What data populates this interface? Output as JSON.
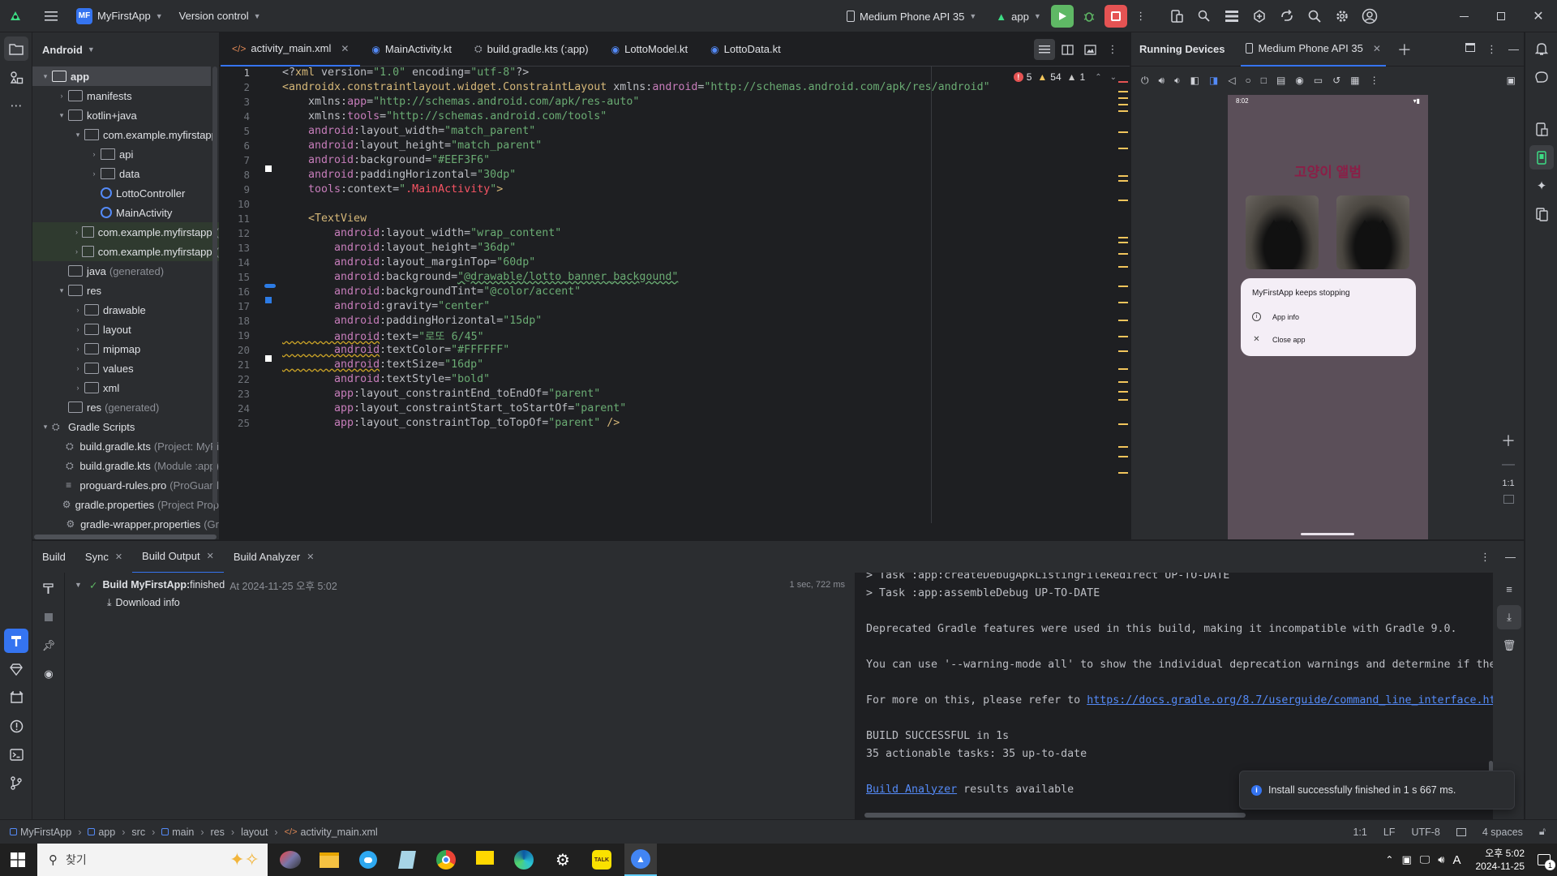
{
  "titlebar": {
    "project_badge": "MF",
    "project_name": "MyFirstApp",
    "vcs": "Version control",
    "device": "Medium Phone API 35",
    "run_config": "app"
  },
  "project_panel": {
    "title": "Android",
    "rows": [
      {
        "label": "app",
        "muted": "",
        "depth": 0,
        "arrow": "▾",
        "icon": "folder"
      },
      {
        "label": "manifests",
        "muted": "",
        "depth": 1,
        "arrow": "›",
        "icon": "folder"
      },
      {
        "label": "kotlin+java",
        "muted": "",
        "depth": 1,
        "arrow": "▾",
        "icon": "folder"
      },
      {
        "label": "com.example.myfirstapp",
        "muted": "",
        "depth": 2,
        "arrow": "▾",
        "icon": "package"
      },
      {
        "label": "api",
        "muted": "",
        "depth": 3,
        "arrow": "›",
        "icon": "package"
      },
      {
        "label": "data",
        "muted": "",
        "depth": 3,
        "arrow": "›",
        "icon": "package"
      },
      {
        "label": "LottoController",
        "muted": "",
        "depth": 3,
        "arrow": "",
        "icon": "kotlin"
      },
      {
        "label": "MainActivity",
        "muted": "",
        "depth": 3,
        "arrow": "",
        "icon": "kotlin"
      },
      {
        "label": "com.example.myfirstapp",
        "muted": "(",
        "depth": 2,
        "arrow": "›",
        "icon": "package"
      },
      {
        "label": "com.example.myfirstapp",
        "muted": "(",
        "depth": 2,
        "arrow": "›",
        "icon": "package"
      },
      {
        "label": "java",
        "muted": "(generated)",
        "depth": 1,
        "arrow": "",
        "icon": "folder"
      },
      {
        "label": "res",
        "muted": "",
        "depth": 1,
        "arrow": "▾",
        "icon": "folder"
      },
      {
        "label": "drawable",
        "muted": "",
        "depth": 2,
        "arrow": "›",
        "icon": "folder"
      },
      {
        "label": "layout",
        "muted": "",
        "depth": 2,
        "arrow": "›",
        "icon": "folder"
      },
      {
        "label": "mipmap",
        "muted": "",
        "depth": 2,
        "arrow": "›",
        "icon": "folder"
      },
      {
        "label": "values",
        "muted": "",
        "depth": 2,
        "arrow": "›",
        "icon": "folder"
      },
      {
        "label": "xml",
        "muted": "",
        "depth": 2,
        "arrow": "›",
        "icon": "folder"
      },
      {
        "label": "res",
        "muted": "(generated)",
        "depth": 1,
        "arrow": "",
        "icon": "folder"
      },
      {
        "label": "Gradle Scripts",
        "muted": "",
        "depth": 0,
        "arrow": "▾",
        "icon": "gradle"
      },
      {
        "label": "build.gradle.kts",
        "muted": "(Project: MyFi",
        "depth": 1,
        "arrow": "",
        "icon": "gradle"
      },
      {
        "label": "build.gradle.kts",
        "muted": "(Module :app)",
        "depth": 1,
        "arrow": "",
        "icon": "gradle"
      },
      {
        "label": "proguard-rules.pro",
        "muted": "(ProGuard",
        "depth": 1,
        "arrow": "",
        "icon": "lines"
      },
      {
        "label": "gradle.properties",
        "muted": "(Project Prop",
        "depth": 1,
        "arrow": "",
        "icon": "gear"
      },
      {
        "label": "gradle-wrapper.properties",
        "muted": "(Gr",
        "depth": 1,
        "arrow": "",
        "icon": "gear"
      }
    ]
  },
  "editor_tabs": [
    {
      "label": "activity_main.xml",
      "icon": "</>",
      "active": true,
      "closable": true
    },
    {
      "label": "MainActivity.kt",
      "icon": "K",
      "active": false,
      "closable": false
    },
    {
      "label": "build.gradle.kts (:app)",
      "icon": "G",
      "active": false,
      "closable": false
    },
    {
      "label": "LottoModel.kt",
      "icon": "K",
      "active": false,
      "closable": false
    },
    {
      "label": "LottoData.kt",
      "icon": "K",
      "active": false,
      "closable": false
    }
  ],
  "inspections": {
    "errors": "5",
    "warnings": "54",
    "weak": "1"
  },
  "code_lines": [
    [
      [
        "pi",
        "<?"
      ],
      [
        "tag",
        "xml "
      ],
      [
        "attr",
        "version="
      ],
      [
        "str",
        "\"1.0\" "
      ],
      [
        "attr",
        "encoding="
      ],
      [
        "str",
        "\"utf-8\""
      ],
      [
        "pi",
        "?>"
      ]
    ],
    [
      [
        "tag",
        "<androidx.constraintlayout.widget.ConstraintLayout "
      ],
      [
        "attr",
        "xmlns:"
      ],
      [
        "ns",
        "android"
      ],
      [
        "attr",
        "="
      ],
      [
        "str",
        "\"http://schemas.android.com/apk/res/android\""
      ]
    ],
    [
      [
        "attr",
        "    xmlns:"
      ],
      [
        "ns",
        "app"
      ],
      [
        "attr",
        "="
      ],
      [
        "str",
        "\"http://schemas.android.com/apk/res-auto\""
      ]
    ],
    [
      [
        "attr",
        "    xmlns:"
      ],
      [
        "ns",
        "tools"
      ],
      [
        "attr",
        "="
      ],
      [
        "str",
        "\"http://schemas.android.com/tools\""
      ]
    ],
    [
      [
        "ns",
        "    android"
      ],
      [
        "attr",
        ":layout_width="
      ],
      [
        "str",
        "\"match_parent\""
      ]
    ],
    [
      [
        "ns",
        "    android"
      ],
      [
        "attr",
        ":layout_height="
      ],
      [
        "str",
        "\"match_parent\""
      ]
    ],
    [
      [
        "ns",
        "    android"
      ],
      [
        "attr",
        ":background="
      ],
      [
        "str",
        "\"#EEF3F6\""
      ]
    ],
    [
      [
        "ns",
        "    android"
      ],
      [
        "attr",
        ":paddingHorizontal="
      ],
      [
        "str",
        "\"30dp\""
      ]
    ],
    [
      [
        "ns",
        "    tools"
      ],
      [
        "attr",
        ":context="
      ],
      [
        "str",
        "\""
      ],
      [
        "red",
        ".MainActivity"
      ],
      [
        "str",
        "\""
      ],
      [
        "tag",
        ">"
      ]
    ],
    [],
    [
      [
        "tag",
        "    <TextView"
      ]
    ],
    [
      [
        "ns",
        "        android"
      ],
      [
        "attr",
        ":layout_width="
      ],
      [
        "str",
        "\"wrap_content\""
      ]
    ],
    [
      [
        "ns",
        "        android"
      ],
      [
        "attr",
        ":layout_height="
      ],
      [
        "str",
        "\"36dp\""
      ]
    ],
    [
      [
        "ns",
        "        android"
      ],
      [
        "attr",
        ":layout_marginTop="
      ],
      [
        "str",
        "\"60dp\""
      ]
    ],
    [
      [
        "ns",
        "        android"
      ],
      [
        "attr",
        ":background="
      ],
      [
        "str",
        "\"@drawable/lotto_banner_backgound\""
      ]
    ],
    [
      [
        "ns",
        "        android"
      ],
      [
        "attr",
        ":backgroundTint="
      ],
      [
        "str",
        "\"@color/accent\""
      ]
    ],
    [
      [
        "ns",
        "        android"
      ],
      [
        "attr",
        ":gravity="
      ],
      [
        "str",
        "\"center\""
      ]
    ],
    [
      [
        "ns",
        "        android"
      ],
      [
        "attr",
        ":paddingHorizontal="
      ],
      [
        "str",
        "\"15dp\""
      ]
    ],
    [
      [
        "ns",
        "        android"
      ],
      [
        "attr",
        ":text="
      ],
      [
        "str",
        "\"로또 6/45\""
      ]
    ],
    [
      [
        "ns",
        "        android"
      ],
      [
        "attr",
        ":textColor="
      ],
      [
        "str",
        "\"#FFFFFF\""
      ]
    ],
    [
      [
        "ns",
        "        android"
      ],
      [
        "attr",
        ":textSize="
      ],
      [
        "str",
        "\"16dp\""
      ]
    ],
    [
      [
        "ns",
        "        android"
      ],
      [
        "attr",
        ":textStyle="
      ],
      [
        "str",
        "\"bold\""
      ]
    ],
    [
      [
        "ns",
        "        app"
      ],
      [
        "attr",
        ":layout_constraintEnd_toEndOf="
      ],
      [
        "str",
        "\"parent\""
      ]
    ],
    [
      [
        "ns",
        "        app"
      ],
      [
        "attr",
        ":layout_constraintStart_toStartOf="
      ],
      [
        "str",
        "\"parent\""
      ]
    ],
    [
      [
        "ns",
        "        app"
      ],
      [
        "attr",
        ":layout_constraintTop_toTopOf="
      ],
      [
        "str",
        "\"parent\" "
      ],
      [
        "tag",
        "/>"
      ]
    ]
  ],
  "running_devices": {
    "title": "Running Devices",
    "tab": "Medium Phone API 35",
    "status_time": "8:02",
    "app_title": "고양이 앨범",
    "dialog_title": "MyFirstApp keeps stopping",
    "dialog_app_info": "App info",
    "dialog_close_app": "Close app",
    "zoom": "1:1"
  },
  "bottom_tabs": [
    {
      "label": "Build",
      "active": false,
      "closable": false
    },
    {
      "label": "Sync",
      "active": false,
      "closable": true
    },
    {
      "label": "Build Output",
      "active": true,
      "closable": true
    },
    {
      "label": "Build Analyzer",
      "active": false,
      "closable": true
    }
  ],
  "build_tree": {
    "title_bold": "Build MyFirstApp:",
    "title_rest": " finished",
    "timestamp": "At 2024-11-25 오후 5:02",
    "duration": "1 sec, 722 ms",
    "child": "Download info"
  },
  "build_log": [
    "> Task :app:createDebugApkListingFileRedirect UP-TO-DATE",
    "> Task :app:assembleDebug UP-TO-DATE",
    "",
    "Deprecated Gradle features were used in this build, making it incompatible with Gradle 9.0.",
    "",
    "You can use '--warning-mode all' to show the individual deprecation warnings and determine if the",
    "",
    "For more on this, please refer to ",
    "",
    "BUILD SUCCESSFUL in 1s",
    "35 actionable tasks: 35 up-to-date",
    "",
    " results available"
  ],
  "build_log_link": "https://docs.gradle.org/8.7/userguide/command_line_interface.ht",
  "build_analyzer_link": "Build Analyzer",
  "toast": "Install successfully finished in 1 s 667 ms.",
  "statusbar": {
    "crumbs": [
      "MyFirstApp",
      "app",
      "src",
      "main",
      "res",
      "layout",
      "activity_main.xml"
    ],
    "position": "1:1",
    "line_sep": "LF",
    "encoding": "UTF-8",
    "indent": "4 spaces"
  },
  "taskbar": {
    "search_placeholder": "찾기",
    "time": "오후 5:02",
    "date": "2024-11-25",
    "ime": "A",
    "notif_count": "1"
  },
  "colors": {
    "accent": "#3574f0",
    "run_green": "#5fb865",
    "stop_red": "#e55353",
    "phone_title": "#8a1f47"
  }
}
